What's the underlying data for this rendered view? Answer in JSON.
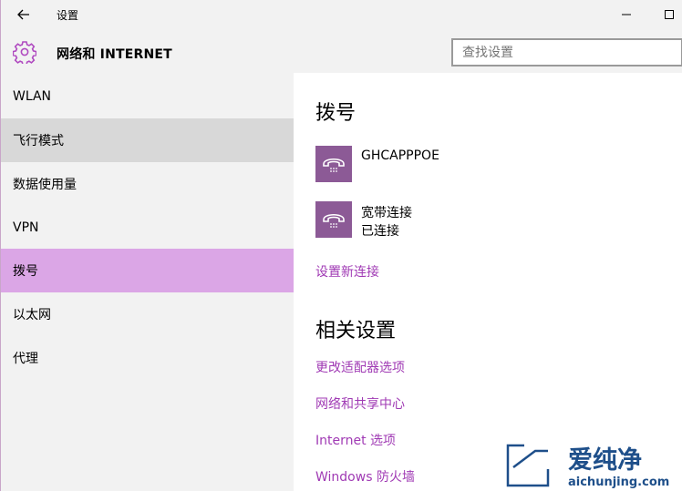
{
  "window": {
    "title": "设置",
    "back_icon": "back-arrow-icon",
    "minimize_icon": "minimize-icon",
    "maximize_icon": "maximize-icon"
  },
  "header": {
    "icon": "gear-icon",
    "title": "网络和 INTERNET",
    "search_placeholder": "查找设置"
  },
  "sidebar": {
    "items": [
      {
        "label": "WLAN",
        "state": "normal"
      },
      {
        "label": "飞行模式",
        "state": "hover"
      },
      {
        "label": "数据使用量",
        "state": "normal"
      },
      {
        "label": "VPN",
        "state": "normal"
      },
      {
        "label": "拨号",
        "state": "selected"
      },
      {
        "label": "以太网",
        "state": "normal"
      },
      {
        "label": "代理",
        "state": "normal"
      }
    ]
  },
  "main": {
    "section_title": "拨号",
    "connections": [
      {
        "name": "GHCAPPPOE",
        "status": "",
        "icon": "phone-icon"
      },
      {
        "name": "宽带连接",
        "status": "已连接",
        "icon": "phone-icon"
      }
    ],
    "new_connection_link": "设置新连接",
    "related_title": "相关设置",
    "related_links": [
      "更改适配器选项",
      "网络和共享中心",
      "Internet 选项",
      "Windows 防火墙"
    ]
  },
  "watermark": {
    "brand": "爱纯净",
    "domain": "aichunjing.com"
  },
  "colors": {
    "accent": "#a03ab4",
    "selected_bg": "#dba6e6",
    "icon_bg": "#8c5a96",
    "gear": "#b04ac0"
  }
}
